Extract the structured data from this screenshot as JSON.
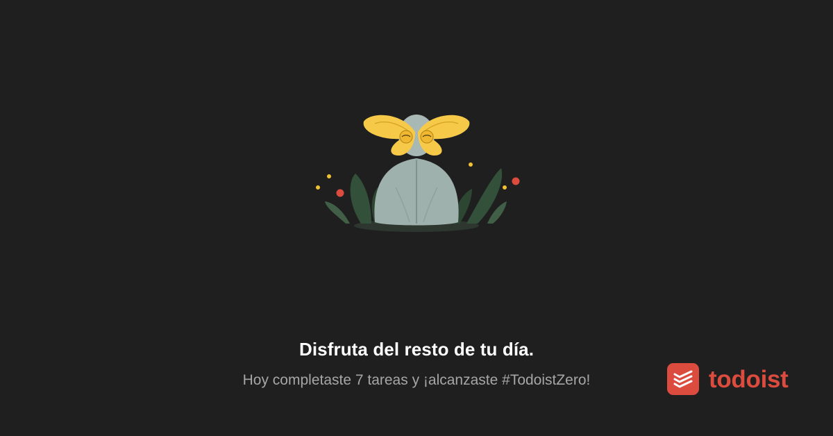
{
  "message": {
    "headline": "Disfruta del resto de tu día.",
    "subline": "Hoy completaste 7 tareas y ¡alcanzaste #TodoistZero!"
  },
  "brand": {
    "name": "todoist",
    "logo_icon": "todoist-logo-icon",
    "color": "#db4c3f"
  },
  "illustration": {
    "icon": "zero-tasks-figure-illustration"
  },
  "colors": {
    "background": "#1f1f1f",
    "headline": "#ffffff",
    "subline": "#a6a6a6",
    "figure": "#9fb1ad",
    "butterfly": "#f7c948",
    "leaves": "#3d5a40",
    "red_dot": "#db4c3f",
    "yellow_dot": "#f2c230"
  }
}
